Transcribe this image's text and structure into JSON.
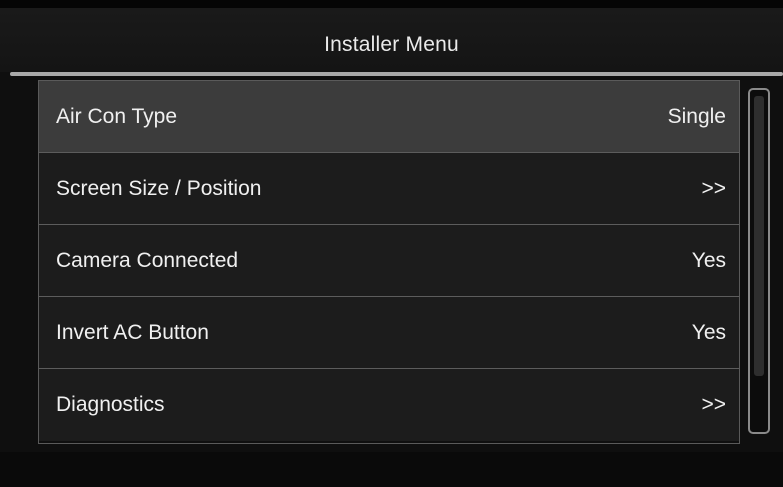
{
  "header": {
    "title": "Installer Menu"
  },
  "menu": {
    "items": [
      {
        "label": "Air Con Type",
        "value": "Single",
        "selected": true
      },
      {
        "label": "Screen Size / Position",
        "value": ">>"
      },
      {
        "label": "Camera Connected",
        "value": "Yes"
      },
      {
        "label": "Invert AC Button",
        "value": "Yes"
      },
      {
        "label": "Diagnostics",
        "value": ">>"
      }
    ]
  },
  "colors": {
    "background": "#0f0f0f",
    "selected_row": "#3c3c3c",
    "row": "#1c1c1c",
    "text": "#f0f0f0",
    "divider": "#a9a9a9"
  }
}
